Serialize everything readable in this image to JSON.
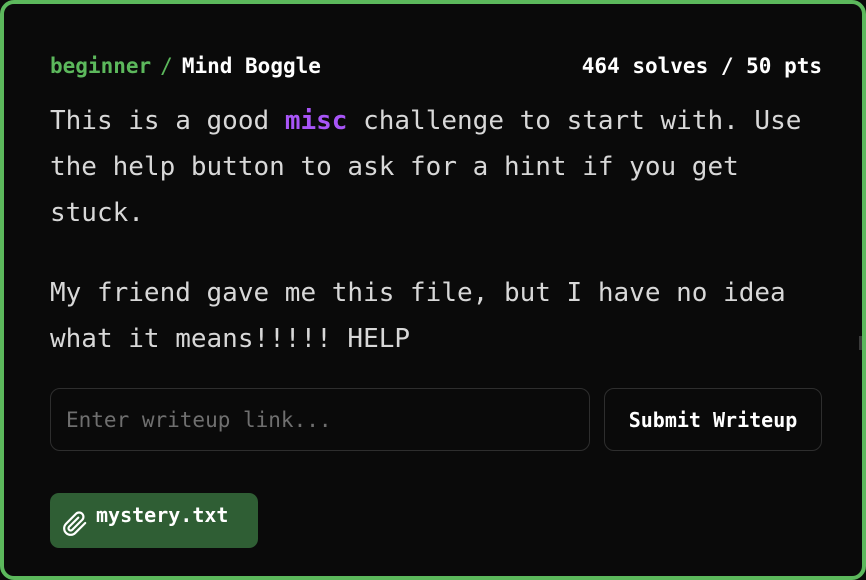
{
  "challenge": {
    "category": "beginner",
    "separator": "/",
    "title": "Mind Boggle",
    "stats": "464 solves / 50 pts"
  },
  "description": {
    "line1_before": "This is a good ",
    "tag": "misc",
    "line1_after": " challenge to start with. Use the help button to ask for a hint if you get stuck.",
    "paragraph2": "My friend gave me this file, but I have no idea what it means!!!!! HELP"
  },
  "writeup": {
    "placeholder": "Enter writeup link...",
    "value": "",
    "submit_label": "Submit Writeup"
  },
  "attachment": {
    "filename": "mystery.txt",
    "icon": "paperclip-icon"
  },
  "colors": {
    "accent": "#5cb85c",
    "tag": "#a855f7",
    "chip_bg": "#2f5e34",
    "background": "#0a0a0a"
  }
}
